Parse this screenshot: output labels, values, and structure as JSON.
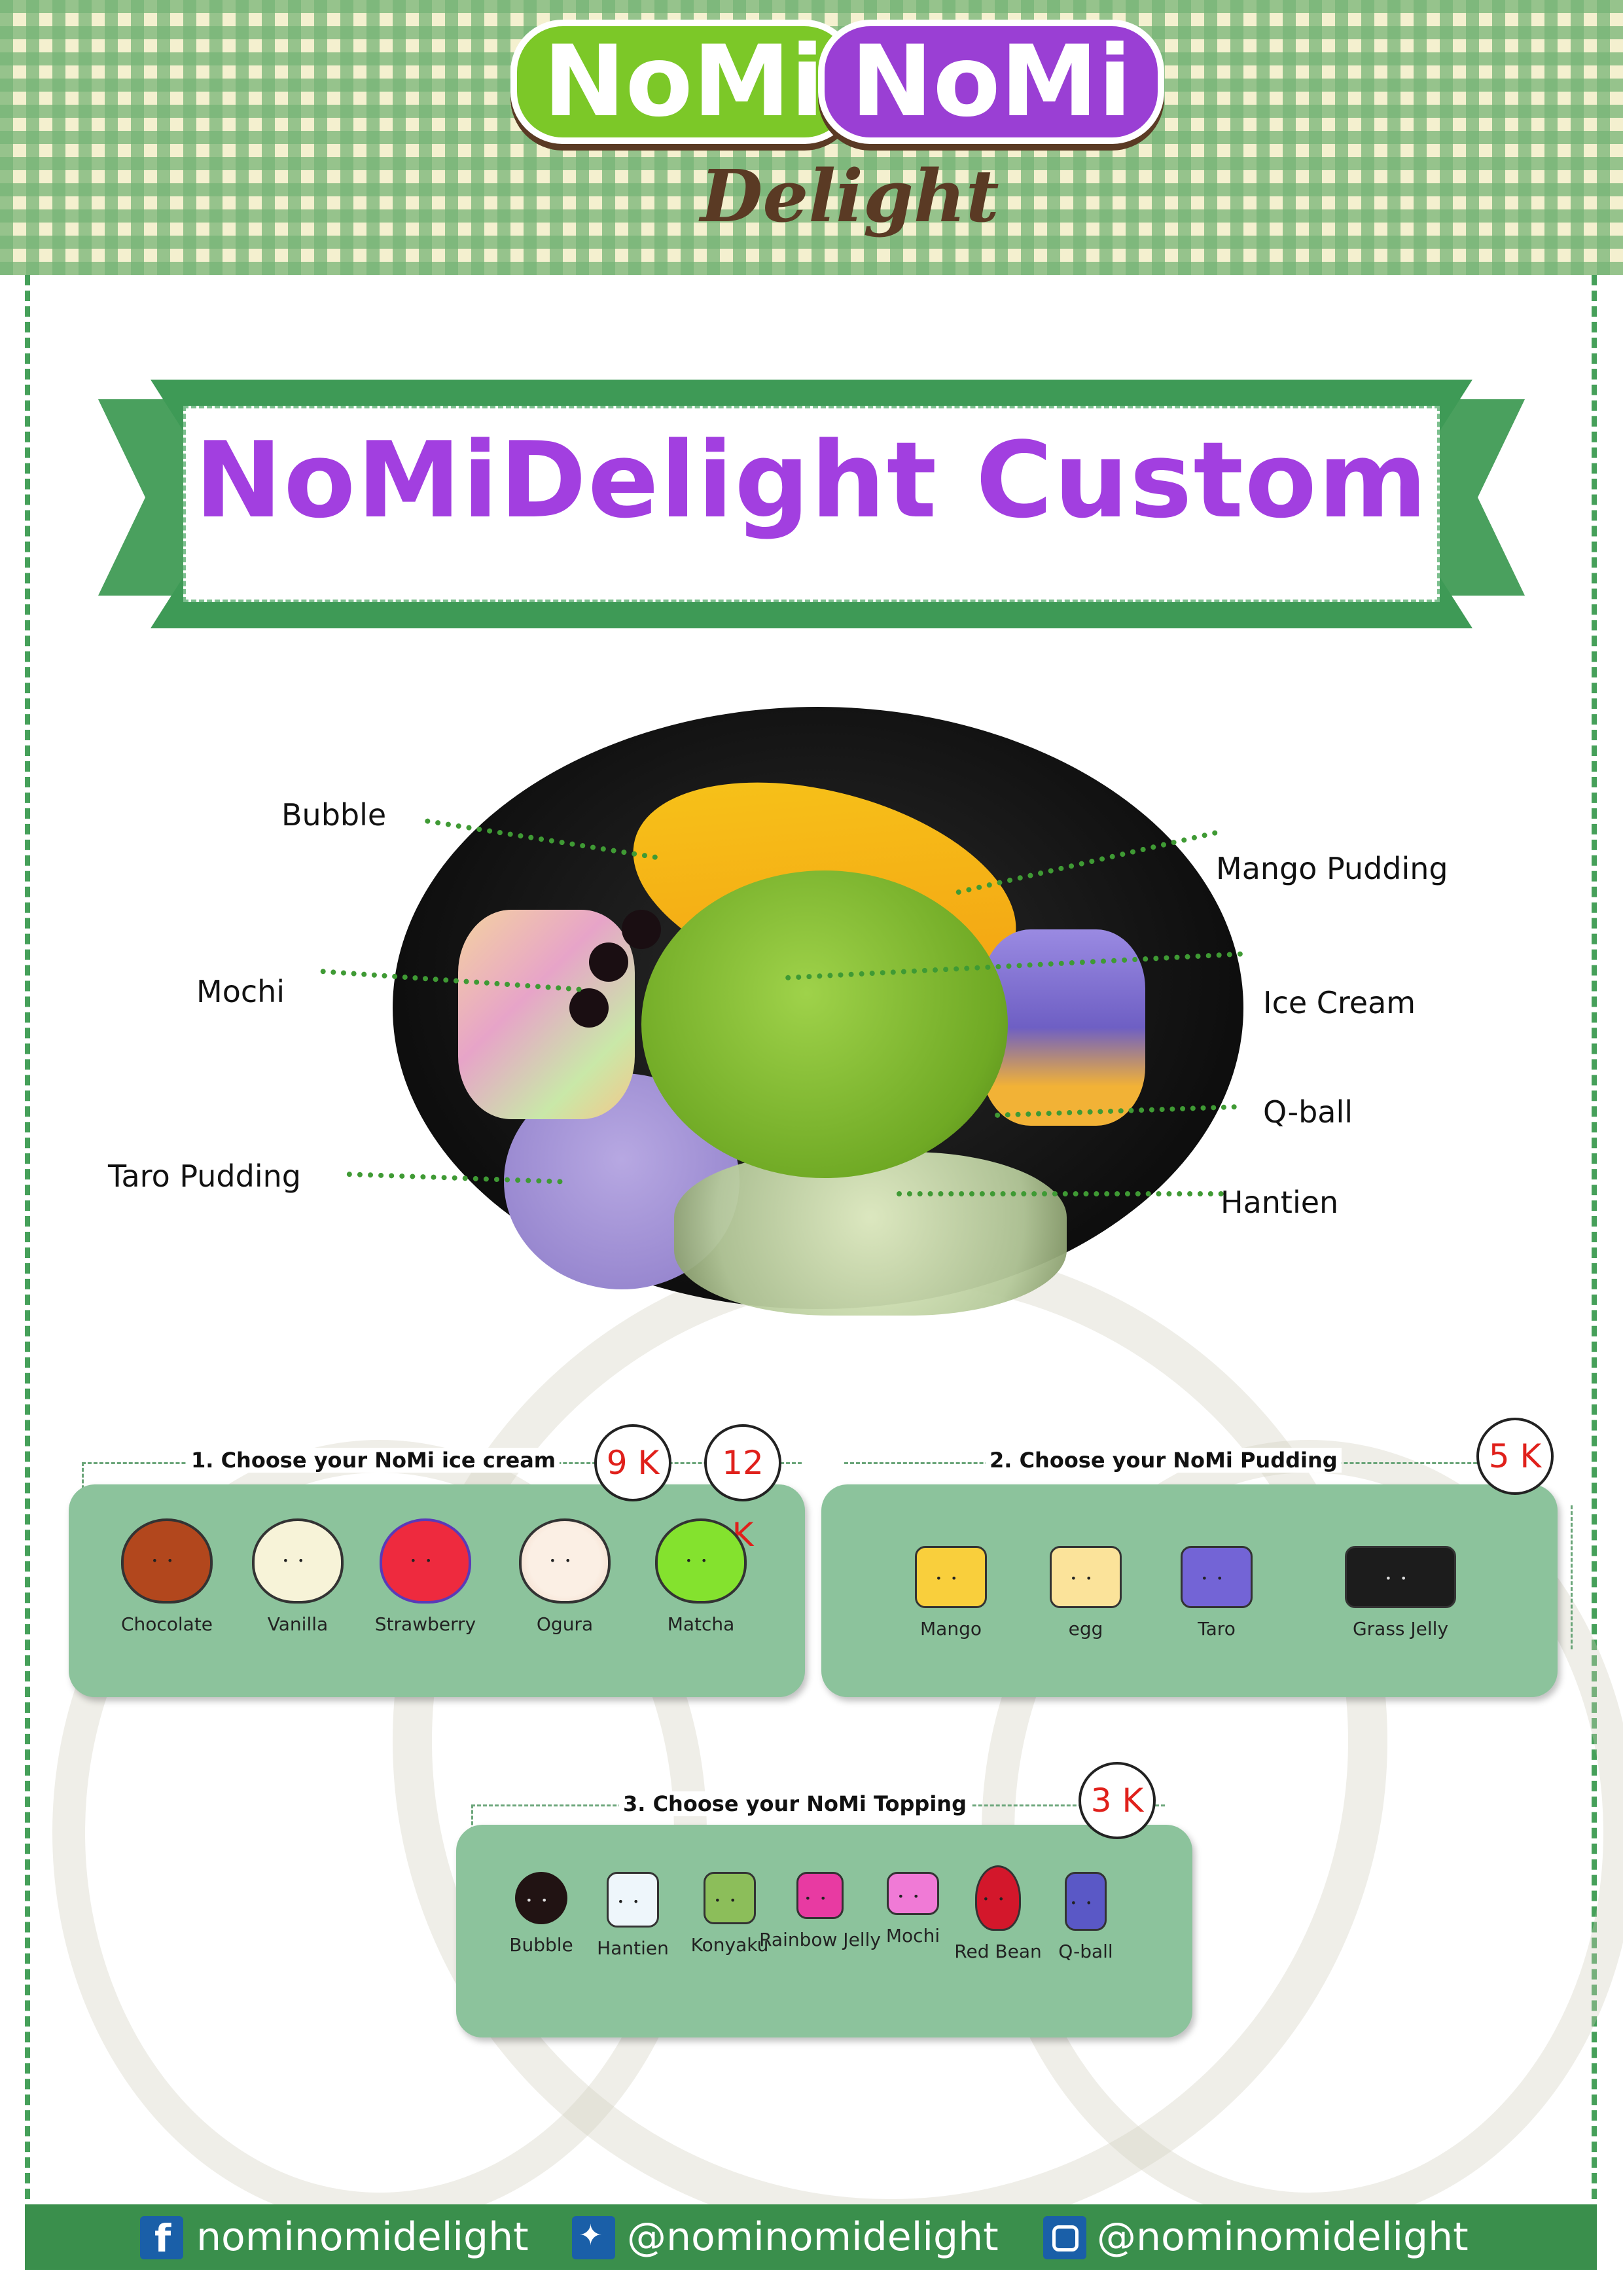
{
  "brand": {
    "logo_word_1": "NoMi",
    "logo_word_2": "NoMi",
    "logo_sub": "Delight"
  },
  "banner": {
    "title": "NoMiDelight Custom"
  },
  "photo_labels": {
    "bubble": "Bubble",
    "mochi": "Mochi",
    "taro_pudding": "Taro Pudding",
    "mango_pudding": "Mango Pudding",
    "ice_cream": "Ice Cream",
    "q_ball": "Q-ball",
    "hantien": "Hantien"
  },
  "step1": {
    "title": "1. Choose your NoMi ice cream",
    "price_1": "9 K",
    "price_2": "12 K",
    "items": [
      "Chocolate",
      "Vanilla",
      "Strawberry",
      "Ogura",
      "Matcha"
    ]
  },
  "step2": {
    "title": "2. Choose your NoMi Pudding",
    "price": "5 K",
    "items": [
      "Mango",
      "egg",
      "Taro",
      "Grass Jelly"
    ]
  },
  "step3": {
    "title": "3. Choose your NoMi Topping",
    "price": "3 K",
    "items": [
      "Bubble",
      "Hantien",
      "Konyaku",
      "Rainbow Jelly",
      "Mochi",
      "Red Bean",
      "Q-ball"
    ]
  },
  "footer": {
    "facebook": "nominomidelight",
    "twitter": "@nominomidelight",
    "instagram": "@nominomidelight"
  },
  "colors": {
    "brand_green": "#3a8f4c",
    "card_green": "#8cc39c",
    "title_purple": "#a23fe0",
    "price_red": "#e0201b"
  },
  "icons": [
    "facebook-icon",
    "twitter-icon",
    "instagram-icon"
  ]
}
